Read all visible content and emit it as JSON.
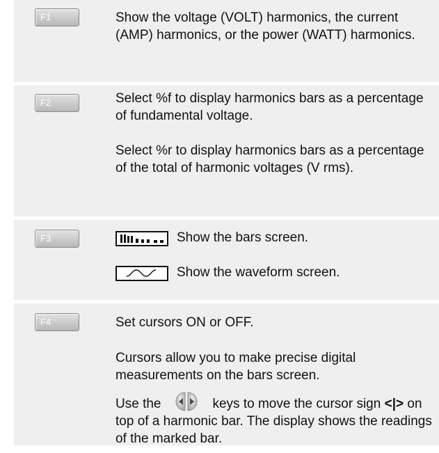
{
  "rows": [
    {
      "key": "F1",
      "paragraphs": [
        "Show the voltage (VOLT) harmonics, the current (AMP) harmonics, or the power (WATT) harmonics."
      ]
    },
    {
      "key": "F2",
      "paragraphs": [
        "Select %f to display harmonics bars as a percentage of fundamental voltage.",
        "Select %r  to display harmonics bars as a percentage of the total of harmonic voltages (V rms)."
      ]
    },
    {
      "key": "F3",
      "bars_text": "Show the bars screen.",
      "wave_text": "Show the waveform screen.",
      "bars_icon": "bars-screen-icon",
      "wave_icon": "waveform-screen-icon"
    },
    {
      "key": "F4",
      "p1": "Set cursors ON or OFF.",
      "p2": "Cursors allow you to make precise digital measurements on the bars screen.",
      "p3_before": "Use the",
      "p3_after": "keys to move the cursor sign",
      "p3_sign": "<|>",
      "p3_end": "on top of a harmonic bar. The display shows the readings of the marked bar.",
      "arrow_icon": "left-right-arrow-keys-icon"
    }
  ]
}
